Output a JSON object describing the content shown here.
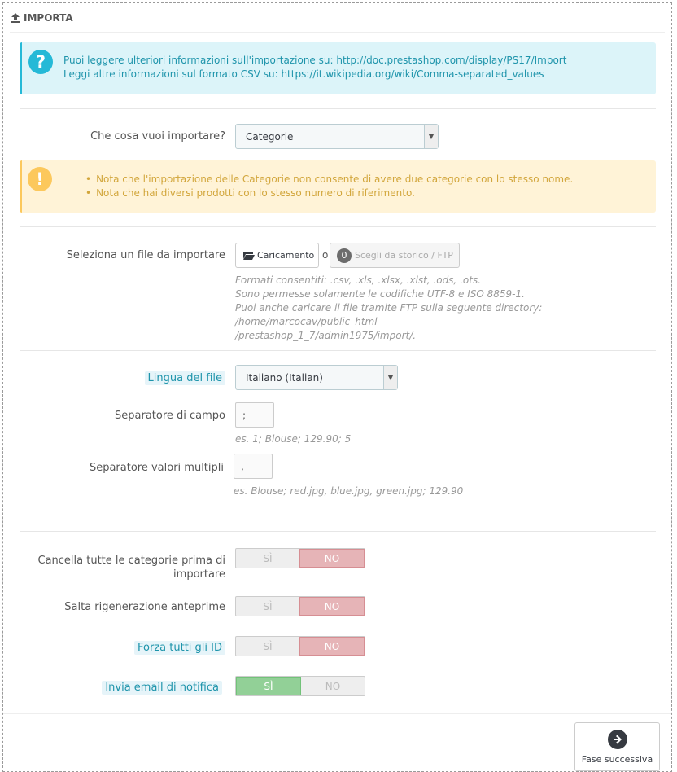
{
  "heading": {
    "title": "IMPORTA",
    "icon": "upload-icon"
  },
  "info_alert": {
    "icon": "question-icon",
    "line1_prefix": "Puoi leggere ulteriori informazioni sull'importazione su:",
    "line1_link": "http://doc.prestashop.com/display/PS17/Import",
    "line2_prefix": "Leggi altre informazioni sul formato CSV su:",
    "line2_link": "https://it.wikipedia.org/wiki/Comma-separated_values"
  },
  "import_what": {
    "label": "Che cosa vuoi importare?",
    "value": "Categorie"
  },
  "warning_alert": {
    "icon": "exclamation-icon",
    "items": [
      "Nota che l'importazione delle Categorie non consente di avere due categorie con lo stesso nome.",
      "Nota che hai diversi prodotti con lo stesso numero di riferimento."
    ]
  },
  "file_select": {
    "label": "Seleziona un file da importare",
    "upload_button": "Caricamento",
    "or_text": "o",
    "history_count": "0",
    "history_button": "Scegli da storico / FTP",
    "help": [
      "Formati consentiti: .csv, .xls, .xlsx, .xlst, .ods, .ots.",
      "Sono permesse solamente le codifiche UTF-8 e ISO 8859-1.",
      "Puoi anche caricare il file tramite FTP sulla seguente directory: /home/marcocav/public_html",
      "/prestashop_1_7/admin1975/import/."
    ]
  },
  "language": {
    "label": "Lingua del file",
    "value": "Italiano (Italian)"
  },
  "field_separator": {
    "label": "Separatore di campo",
    "value": ";",
    "help": "es. 1; Blouse; 129.90; 5"
  },
  "multi_separator": {
    "label": "Separatore valori multipli",
    "value": ",",
    "help": "es. Blouse; red.jpg, blue.jpg, green.jpg; 129.90"
  },
  "toggles": [
    {
      "label_line1": "Cancella tutte le categorie prima di",
      "label_line2": "importare",
      "yes": "SÌ",
      "no": "NO",
      "value": "no"
    },
    {
      "label_line1": "Salta rigenerazione anteprime",
      "yes": "SÌ",
      "no": "NO",
      "value": "no"
    },
    {
      "label_line1": "Forza tutti gli ID",
      "yes": "SÌ",
      "no": "NO",
      "value": "no"
    },
    {
      "label_line1": "Invia email di notifica",
      "yes": "SÌ",
      "no": "NO",
      "value": "yes"
    }
  ],
  "footer": {
    "next_button": "Fase successiva",
    "icon": "arrow-right-circle-icon"
  }
}
